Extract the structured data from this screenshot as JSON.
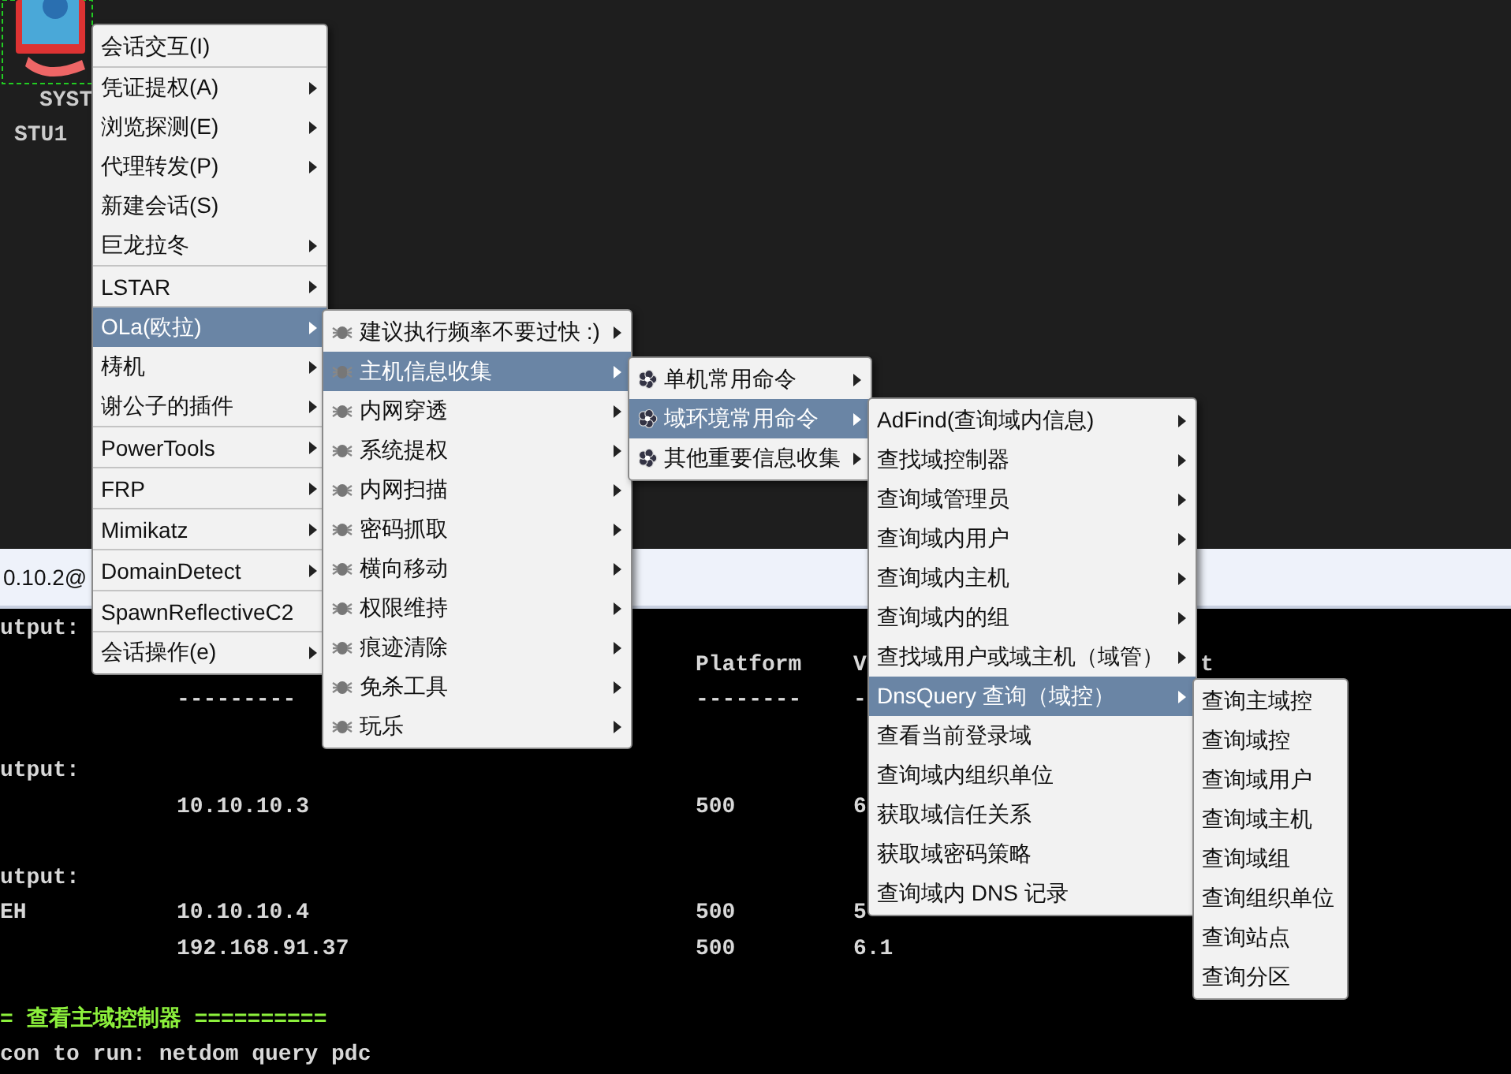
{
  "session": {
    "user": "SYST",
    "host": "STU1"
  },
  "tab": {
    "label": "0.10.2@"
  },
  "console": [
    {
      "kind": "text",
      "column_1": "utput:"
    },
    {
      "kind": "text",
      "column_3": "Platform",
      "column_4": "V",
      "column_5": "t"
    },
    {
      "kind": "text",
      "column_2": "---------",
      "column_3": "--------",
      "column_4": "-"
    },
    {
      "kind": "blank"
    },
    {
      "kind": "text",
      "column_1": "utput:"
    },
    {
      "kind": "text",
      "column_2": "10.10.10.3",
      "column_3": "500",
      "column_4": "6"
    },
    {
      "kind": "blank"
    },
    {
      "kind": "text",
      "column_1": "utput:"
    },
    {
      "kind": "text",
      "column_1": "EH",
      "column_2": "10.10.10.4",
      "column_3": "500",
      "column_4": "5"
    },
    {
      "kind": "text",
      "column_2": "192.168.91.37",
      "column_3": "500",
      "column_4": "6.1"
    },
    {
      "kind": "blank"
    },
    {
      "kind": "heading",
      "column_1": "= 查看主域控制器 =========="
    },
    {
      "kind": "text",
      "column_1": "con to run: netdom query pdc"
    }
  ],
  "menus": [
    {
      "kind": "plain",
      "items": [
        {
          "label": "会话交互(I)",
          "selected": false,
          "submenu": false,
          "divider": true
        },
        {
          "label": "凭证提权(A)",
          "selected": false,
          "submenu": true,
          "divider": false
        },
        {
          "label": "浏览探测(E)",
          "selected": false,
          "submenu": true,
          "divider": false
        },
        {
          "label": "代理转发(P)",
          "selected": false,
          "submenu": true,
          "divider": false
        },
        {
          "label": "新建会话(S)",
          "selected": false,
          "submenu": false,
          "divider": false
        },
        {
          "label": "巨龙拉冬",
          "selected": false,
          "submenu": true,
          "divider": true
        },
        {
          "label": "LSTAR",
          "selected": false,
          "submenu": true,
          "divider": true
        },
        {
          "label": "OLa(欧拉)",
          "selected": true,
          "submenu": true,
          "divider": false
        },
        {
          "label": "梼机",
          "selected": false,
          "submenu": true,
          "divider": false
        },
        {
          "label": "谢公子的插件",
          "selected": false,
          "submenu": true,
          "divider": true
        },
        {
          "label": "PowerTools",
          "selected": false,
          "submenu": true,
          "divider": true
        },
        {
          "label": "FRP",
          "selected": false,
          "submenu": true,
          "divider": true
        },
        {
          "label": "Mimikatz",
          "selected": false,
          "submenu": true,
          "divider": true
        },
        {
          "label": "DomainDetect",
          "selected": false,
          "submenu": true,
          "divider": true
        },
        {
          "label": "SpawnReflectiveC2",
          "selected": false,
          "submenu": false,
          "divider": true
        },
        {
          "label": "会话操作(e)",
          "selected": false,
          "submenu": true,
          "divider": false
        }
      ]
    },
    {
      "kind": "bug",
      "items": [
        {
          "label": "建议执行频率不要过快 :)",
          "selected": false,
          "submenu": true,
          "divider": false
        },
        {
          "label": "主机信息收集",
          "selected": true,
          "submenu": true,
          "divider": false
        },
        {
          "label": "内网穿透",
          "selected": false,
          "submenu": true,
          "divider": false
        },
        {
          "label": "系统提权",
          "selected": false,
          "submenu": true,
          "divider": false
        },
        {
          "label": "内网扫描",
          "selected": false,
          "submenu": true,
          "divider": false
        },
        {
          "label": "密码抓取",
          "selected": false,
          "submenu": true,
          "divider": false
        },
        {
          "label": "横向移动",
          "selected": false,
          "submenu": true,
          "divider": false
        },
        {
          "label": "权限维持",
          "selected": false,
          "submenu": true,
          "divider": false
        },
        {
          "label": "痕迹清除",
          "selected": false,
          "submenu": true,
          "divider": false
        },
        {
          "label": "免杀工具",
          "selected": false,
          "submenu": true,
          "divider": false
        },
        {
          "label": "玩乐",
          "selected": false,
          "submenu": true,
          "divider": false
        }
      ]
    },
    {
      "kind": "flower",
      "items": [
        {
          "label": "单机常用命令",
          "selected": false,
          "submenu": true,
          "divider": false
        },
        {
          "label": "域环境常用命令",
          "selected": true,
          "submenu": true,
          "divider": false
        },
        {
          "label": "其他重要信息收集",
          "selected": false,
          "submenu": true,
          "divider": false
        }
      ]
    },
    {
      "kind": "plain",
      "items": [
        {
          "label": "AdFind(查询域内信息)",
          "selected": false,
          "submenu": true,
          "divider": false
        },
        {
          "label": "查找域控制器",
          "selected": false,
          "submenu": true,
          "divider": false
        },
        {
          "label": "查询域管理员",
          "selected": false,
          "submenu": true,
          "divider": false
        },
        {
          "label": "查询域内用户",
          "selected": false,
          "submenu": true,
          "divider": false
        },
        {
          "label": "查询域内主机",
          "selected": false,
          "submenu": true,
          "divider": false
        },
        {
          "label": "查询域内的组",
          "selected": false,
          "submenu": true,
          "divider": false
        },
        {
          "label": "查找域用户或域主机（域管）",
          "selected": false,
          "submenu": true,
          "divider": false
        },
        {
          "label": "DnsQuery 查询（域控）",
          "selected": true,
          "submenu": true,
          "divider": false
        },
        {
          "label": "查看当前登录域",
          "selected": false,
          "submenu": false,
          "divider": false
        },
        {
          "label": "查询域内组织单位",
          "selected": false,
          "submenu": false,
          "divider": false
        },
        {
          "label": "获取域信任关系",
          "selected": false,
          "submenu": false,
          "divider": false
        },
        {
          "label": "获取域密码策略",
          "selected": false,
          "submenu": false,
          "divider": false
        },
        {
          "label": "查询域内 DNS 记录",
          "selected": false,
          "submenu": false,
          "divider": false
        }
      ]
    },
    {
      "kind": "plain",
      "items": [
        {
          "label": "查询主域控",
          "selected": false,
          "submenu": false,
          "divider": false
        },
        {
          "label": "查询域控",
          "selected": false,
          "submenu": false,
          "divider": false
        },
        {
          "label": "查询域用户",
          "selected": false,
          "submenu": false,
          "divider": false
        },
        {
          "label": "查询域主机",
          "selected": false,
          "submenu": false,
          "divider": false
        },
        {
          "label": "查询域组",
          "selected": false,
          "submenu": false,
          "divider": false
        },
        {
          "label": "查询组织单位",
          "selected": false,
          "submenu": false,
          "divider": false
        },
        {
          "label": "查询站点",
          "selected": false,
          "submenu": false,
          "divider": false
        },
        {
          "label": "查询分区",
          "selected": false,
          "submenu": false,
          "divider": false
        }
      ]
    }
  ]
}
